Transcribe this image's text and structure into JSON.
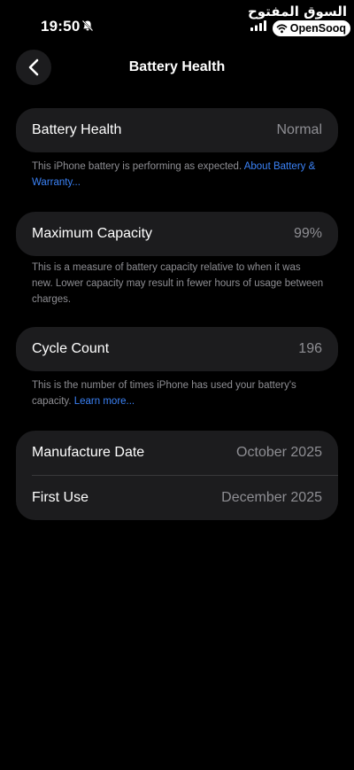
{
  "status_bar": {
    "time": "19:50",
    "icons": [
      "bell-slash-icon",
      "signal-icon"
    ]
  },
  "watermark": {
    "arabic": "السوق المفتوح",
    "brand": "OpenSooq"
  },
  "nav": {
    "title": "Battery Health",
    "back_icon": "chevron-left-icon"
  },
  "battery_health": {
    "label": "Battery Health",
    "value": "Normal",
    "footnote": "This iPhone battery is performing as expected.",
    "link": "About Battery & Warranty..."
  },
  "maximum_capacity": {
    "label": "Maximum Capacity",
    "value": "99%",
    "footnote": "This is a measure of battery capacity relative to when it was new. Lower capacity may result in fewer hours of usage between charges."
  },
  "cycle_count": {
    "label": "Cycle Count",
    "value": "196",
    "footnote": "This is the number of times iPhone has used your battery's capacity.",
    "link": "Learn more..."
  },
  "dates": {
    "manufacture_label": "Manufacture Date",
    "manufacture_value": "October 2025",
    "first_use_label": "First Use",
    "first_use_value": "December 2025"
  },
  "colors": {
    "background": "#000000",
    "card": "#1c1c1e",
    "secondary_text": "#8e8e93",
    "link": "#3b82f6"
  }
}
